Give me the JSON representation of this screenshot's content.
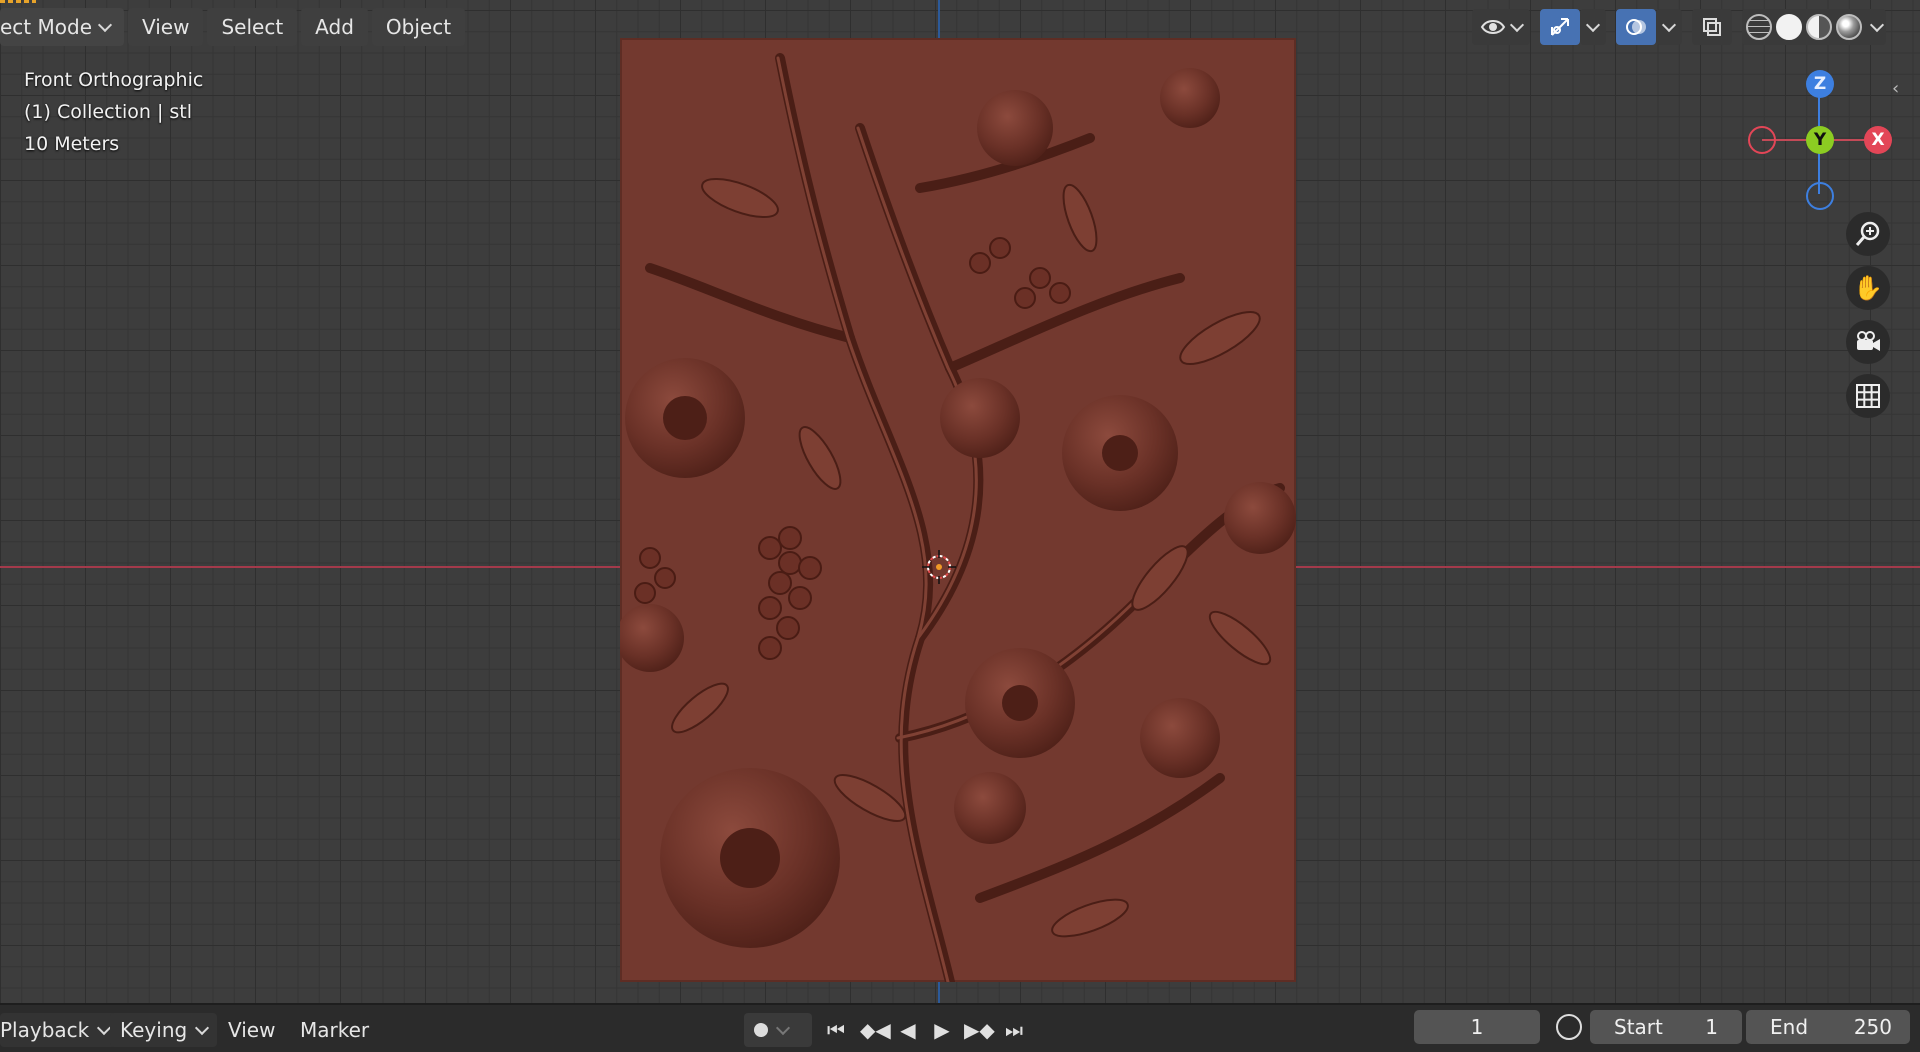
{
  "header": {
    "mode_label": "ect Mode",
    "menus": [
      "View",
      "Select",
      "Add",
      "Object"
    ]
  },
  "viewport": {
    "view_name": "Front Orthographic",
    "collection_info": "(1) Collection | stl",
    "scale_label": "10 Meters"
  },
  "gizmo": {
    "x_label": "X",
    "y_label": "Y",
    "z_label": "Z"
  },
  "timeline": {
    "playback": "Playback",
    "keying": "Keying",
    "view": "View",
    "marker": "Marker",
    "current_frame": "1",
    "start_label": "Start",
    "start_value": "1",
    "end_label": "End",
    "end_value": "250"
  },
  "icons": [
    "visibility-icon",
    "gizmo-icon",
    "overlay-icon",
    "xray-icon",
    "wireframe-shading-icon",
    "solid-shading-icon",
    "material-shading-icon",
    "rendered-shading-icon",
    "zoom-icon",
    "pan-hand-icon",
    "camera-icon",
    "grid-icon",
    "record-icon",
    "jump-start-icon",
    "prev-keyframe-icon",
    "play-reverse-icon",
    "play-icon",
    "next-keyframe-icon",
    "jump-end-icon",
    "stopwatch-icon"
  ],
  "colors": {
    "relief": "#73392f",
    "x_axis": "#e34657",
    "y_axis": "#8ccc22",
    "z_axis": "#3d7fe0",
    "accent": "#4772b3"
  }
}
